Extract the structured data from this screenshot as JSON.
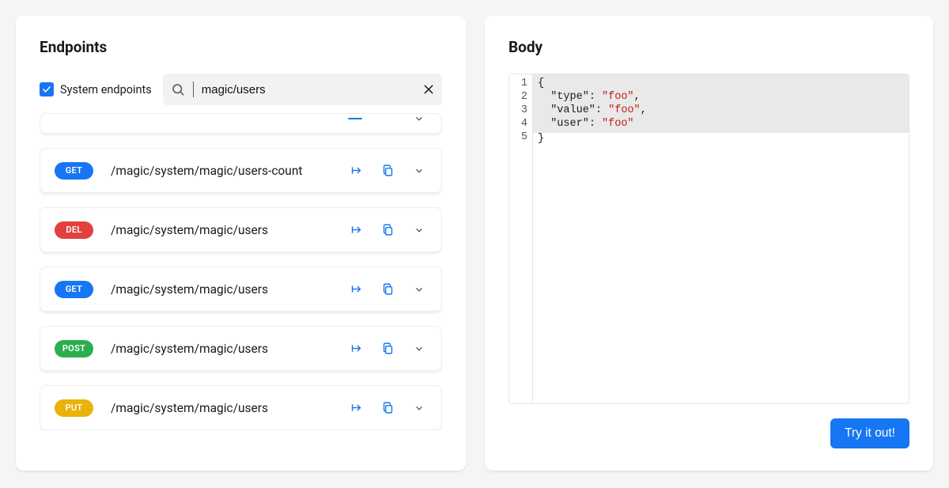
{
  "left": {
    "title": "Endpoints",
    "system_checkbox_label": "System endpoints",
    "system_checkbox_checked": true,
    "search_value": "magic/users",
    "methods": {
      "get": "GET",
      "del": "DEL",
      "post": "POST",
      "put": "PUT"
    },
    "endpoints": [
      {
        "method": "get",
        "path": "/magic/system/magic/users-count"
      },
      {
        "method": "del",
        "path": "/magic/system/magic/users"
      },
      {
        "method": "get",
        "path": "/magic/system/magic/users"
      },
      {
        "method": "post",
        "path": "/magic/system/magic/users"
      },
      {
        "method": "put",
        "path": "/magic/system/magic/users"
      }
    ]
  },
  "right": {
    "title": "Body",
    "gutter": [
      "1",
      "2",
      "3",
      "4",
      "5"
    ],
    "code": {
      "l1": "{",
      "l2k": "\"type\"",
      "l2v": "\"foo\"",
      "l3k": "\"value\"",
      "l3v": "\"foo\"",
      "l4k": "\"user\"",
      "l4v": "\"foo\"",
      "l5": "}"
    },
    "try_label": "Try it out!"
  }
}
